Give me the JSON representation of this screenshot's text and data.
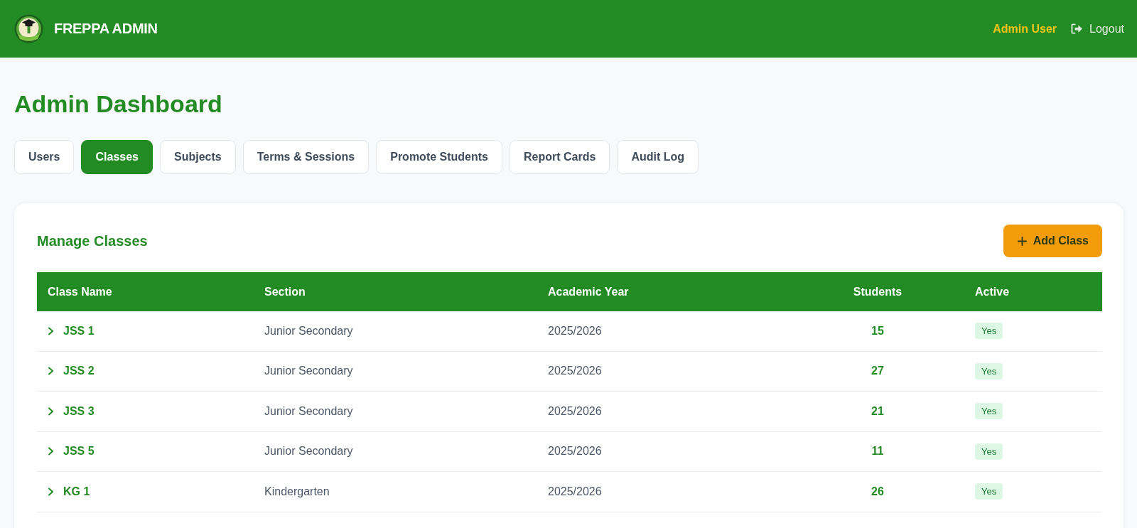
{
  "header": {
    "brand": "FREPPA ADMIN",
    "user_name": "Admin User",
    "logout_label": "Logout"
  },
  "page_title": "Admin Dashboard",
  "tabs": [
    {
      "label": "Users",
      "selected": false
    },
    {
      "label": "Classes",
      "selected": true
    },
    {
      "label": "Subjects",
      "selected": false
    },
    {
      "label": "Terms & Sessions",
      "selected": false
    },
    {
      "label": "Promote Students",
      "selected": false
    },
    {
      "label": "Report Cards",
      "selected": false
    },
    {
      "label": "Audit Log",
      "selected": false
    }
  ],
  "panel": {
    "title": "Manage Classes",
    "add_button": "Add Class",
    "table": {
      "columns": [
        "Class Name",
        "Section",
        "Academic Year",
        "Students",
        "Active"
      ],
      "rows": [
        {
          "class_name": "JSS 1",
          "expanded": false,
          "section": "Junior Secondary",
          "academic_year": "2025/2026",
          "students": "15",
          "active": "Yes"
        },
        {
          "class_name": "JSS 2",
          "expanded": false,
          "section": "Junior Secondary",
          "academic_year": "2025/2026",
          "students": "27",
          "active": "Yes"
        },
        {
          "class_name": "JSS 3",
          "expanded": false,
          "section": "Junior Secondary",
          "academic_year": "2025/2026",
          "students": "21",
          "active": "Yes"
        },
        {
          "class_name": "JSS 5",
          "expanded": false,
          "section": "Junior Secondary",
          "academic_year": "2025/2026",
          "students": "11",
          "active": "Yes"
        },
        {
          "class_name": "KG 1",
          "expanded": false,
          "section": "Kindergarten",
          "academic_year": "2025/2026",
          "students": "26",
          "active": "Yes"
        }
      ]
    }
  }
}
